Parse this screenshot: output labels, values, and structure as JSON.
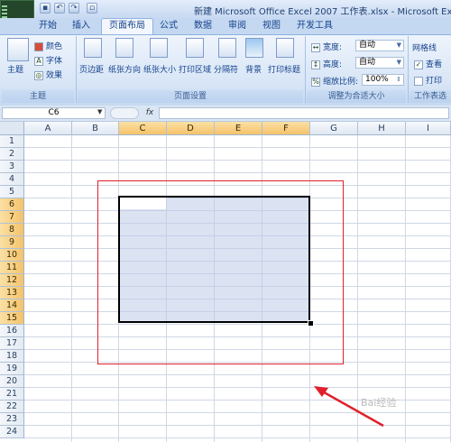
{
  "window": {
    "title": "新建 Microsoft Office Excel 2007 工作表.xlsx - Microsoft Exce"
  },
  "quick_access": {
    "icons": [
      "save-icon",
      "undo-icon",
      "redo-icon",
      "print-preview-icon"
    ]
  },
  "tabs": [
    {
      "label": "开始",
      "active": false
    },
    {
      "label": "插入",
      "active": false
    },
    {
      "label": "页面布局",
      "active": true
    },
    {
      "label": "公式",
      "active": false
    },
    {
      "label": "数据",
      "active": false
    },
    {
      "label": "审阅",
      "active": false
    },
    {
      "label": "视图",
      "active": false
    },
    {
      "label": "开发工具",
      "active": false
    }
  ],
  "ribbon": {
    "theme_group": {
      "label": "主题",
      "theme_button": "主题",
      "colors": "颜色",
      "fonts": "字体",
      "effects": "效果"
    },
    "page_setup_group": {
      "label": "页面设置",
      "buttons": [
        "页边距",
        "纸张方向",
        "纸张大小",
        "打印区域",
        "分隔符",
        "背景",
        "打印标题"
      ]
    },
    "scale_group": {
      "label": "调整为合适大小",
      "width_label": "宽度:",
      "width_value": "自动",
      "height_label": "高度:",
      "height_value": "自动",
      "scale_label": "缩放比例:",
      "scale_value": "100%"
    },
    "sheet_options_group": {
      "label": "工作表选",
      "gridlines_label": "网格线",
      "view_label": "查看",
      "view_checked": true,
      "print_label": "打印",
      "print_checked": false
    }
  },
  "formula_bar": {
    "name_box": "C6",
    "fx_label": "fx",
    "formula": ""
  },
  "grid": {
    "columns": [
      "A",
      "B",
      "C",
      "D",
      "E",
      "F",
      "G",
      "H",
      "I"
    ],
    "selected_columns": [
      "C",
      "D",
      "E",
      "F"
    ],
    "rows": [
      "1",
      "2",
      "3",
      "4",
      "5",
      "6",
      "7",
      "8",
      "9",
      "10",
      "11",
      "12",
      "13",
      "14",
      "15",
      "16",
      "17",
      "18",
      "19",
      "20",
      "21",
      "22",
      "23",
      "24"
    ],
    "selected_rows": [
      "6",
      "7",
      "8",
      "9",
      "10",
      "11",
      "12",
      "13",
      "14",
      "15"
    ],
    "active_cell": "C6",
    "selection_range": "C6:F15"
  },
  "annotation": {
    "highlight_color": "#e0202a",
    "arrow_color": "#e0202a"
  },
  "watermark": "Bai经验"
}
